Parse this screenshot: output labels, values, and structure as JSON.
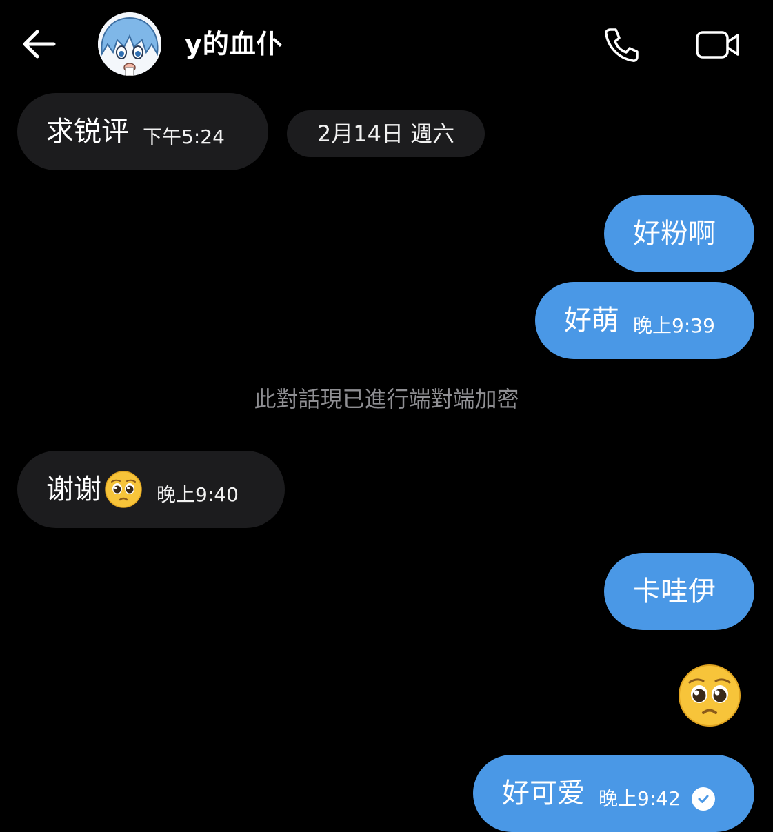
{
  "header": {
    "contact_name": "y的血仆",
    "back_icon": "arrow-left-icon",
    "call_icon": "phone-icon",
    "video_icon": "video-camera-icon"
  },
  "date_separator": "2月14日 週六",
  "system_notice": "此對話現已進行端對端加密",
  "messages": [
    {
      "direction": "in",
      "text": "求锐评",
      "time": "下午5:24"
    },
    {
      "direction": "out",
      "text": "好粉啊",
      "time": ""
    },
    {
      "direction": "out",
      "text": "好萌",
      "time": "晚上9:39"
    },
    {
      "direction": "in",
      "text": "谢谢",
      "emoji": "pleading-face-emoji",
      "time": "晚上9:40"
    },
    {
      "direction": "out",
      "text": "卡哇伊",
      "time": ""
    },
    {
      "direction": "out",
      "emoji": "pleading-face-emoji",
      "time": ""
    },
    {
      "direction": "out",
      "text": "好可爱",
      "time": "晚上9:42",
      "status": "read"
    }
  ],
  "colors": {
    "background": "#000000",
    "incoming_bubble": "#1c1c1e",
    "outgoing_bubble": "#4a98e6",
    "notice_text": "#8f8f93"
  }
}
